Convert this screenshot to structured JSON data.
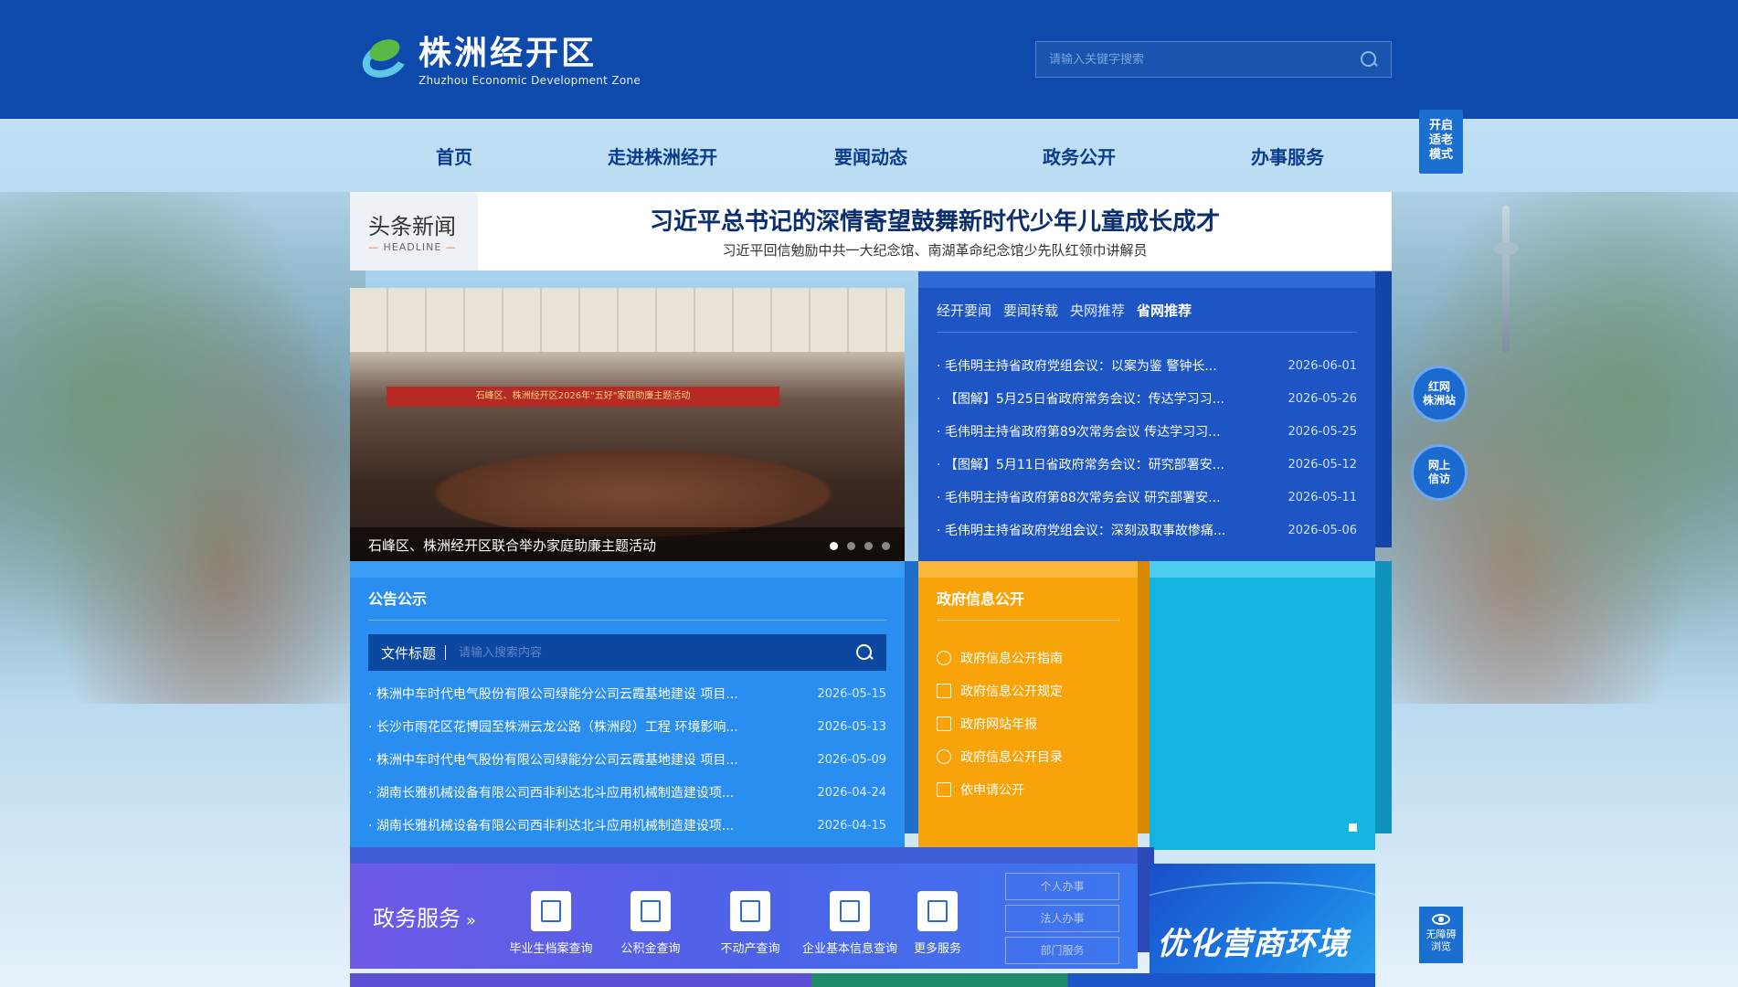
{
  "header": {
    "logo_cn": "株洲经开区",
    "logo_en": "Zhuzhou Economic Development Zone",
    "search_placeholder": "请输入关键字搜索"
  },
  "nav": [
    "首页",
    "走进株洲经开",
    "要闻动态",
    "政务公开",
    "办事服务"
  ],
  "elder_mode": "开启\n适老\n模式",
  "headline": {
    "tag": "头条新闻",
    "tag_en": "HEADLINE",
    "title": "习近平总书记的深情寄望鼓舞新时代少年儿童成长成才",
    "subtitle": "习近平回信勉励中共一大纪念馆、南湖革命纪念馆少先队红领巾讲解员"
  },
  "carousel": {
    "caption": "石峰区、株洲经开区联合举办家庭助廉主题活动",
    "banner": "石峰区、株洲经开区2026年\"五好\"家庭助廉主题活动"
  },
  "news": {
    "tabs": [
      "经开要闻",
      "要闻转载",
      "央网推荐",
      "省网推荐"
    ],
    "active_tab": "省网推荐",
    "items": [
      {
        "title": "毛伟明主持省政府党组会议：以案为鉴 警钟长...",
        "date": "2026-06-01"
      },
      {
        "title": "【图解】5月25日省政府常务会议：传达学习习...",
        "date": "2026-05-26"
      },
      {
        "title": "毛伟明主持省政府第89次常务会议 传达学习习...",
        "date": "2026-05-25"
      },
      {
        "title": "【图解】5月11日省政府常务会议：研究部署安...",
        "date": "2026-05-12"
      },
      {
        "title": "毛伟明主持省政府第88次常务会议 研究部署安...",
        "date": "2026-05-11"
      },
      {
        "title": "毛伟明主持省政府党组会议：深刻汲取事故惨痛...",
        "date": "2026-05-06"
      }
    ]
  },
  "notice": {
    "title": "公告公示",
    "search_label": "文件标题",
    "search_placeholder": "请输入搜索内容",
    "items": [
      {
        "title": "株洲中车时代电气股份有限公司绿能分公司云霞基地建设 项目...",
        "date": "2026-05-15"
      },
      {
        "title": "长沙市雨花区花博园至株洲云龙公路（株洲段）工程 环境影响...",
        "date": "2026-05-13"
      },
      {
        "title": "株洲中车时代电气股份有限公司绿能分公司云霞基地建设 项目...",
        "date": "2026-05-09"
      },
      {
        "title": "湖南长雅机械设备有限公司西非利达北斗应用机械制造建设项...",
        "date": "2026-04-24"
      },
      {
        "title": "湖南长雅机械设备有限公司西非利达北斗应用机械制造建设项...",
        "date": "2026-04-15"
      }
    ]
  },
  "govinfo": {
    "title": "政府信息公开",
    "items": [
      "政府信息公开指南",
      "政府信息公开规定",
      "政府网站年报",
      "政府信息公开目录",
      "依申请公开"
    ]
  },
  "services": {
    "title": "政务服务",
    "arrow": "»",
    "items": [
      "毕业生档案查询",
      "公积金查询",
      "不动产查询",
      "企业基本信息查询",
      "更多服务"
    ],
    "tabs": [
      "个人办事",
      "法人办事",
      "部门服务"
    ]
  },
  "promo": {
    "text": "优化营商环境"
  },
  "float": {
    "red_net": "红网\n株洲站",
    "petition": "网上\n信访",
    "accessibility": "无障碍\n浏览"
  },
  "colors": {
    "header": "#0d4aab",
    "news_panel": "#1d55c4",
    "notice_panel": "#2a8ef0",
    "govinfo_panel": "#f9a30a",
    "cyan_panel": "#13b4e0"
  }
}
